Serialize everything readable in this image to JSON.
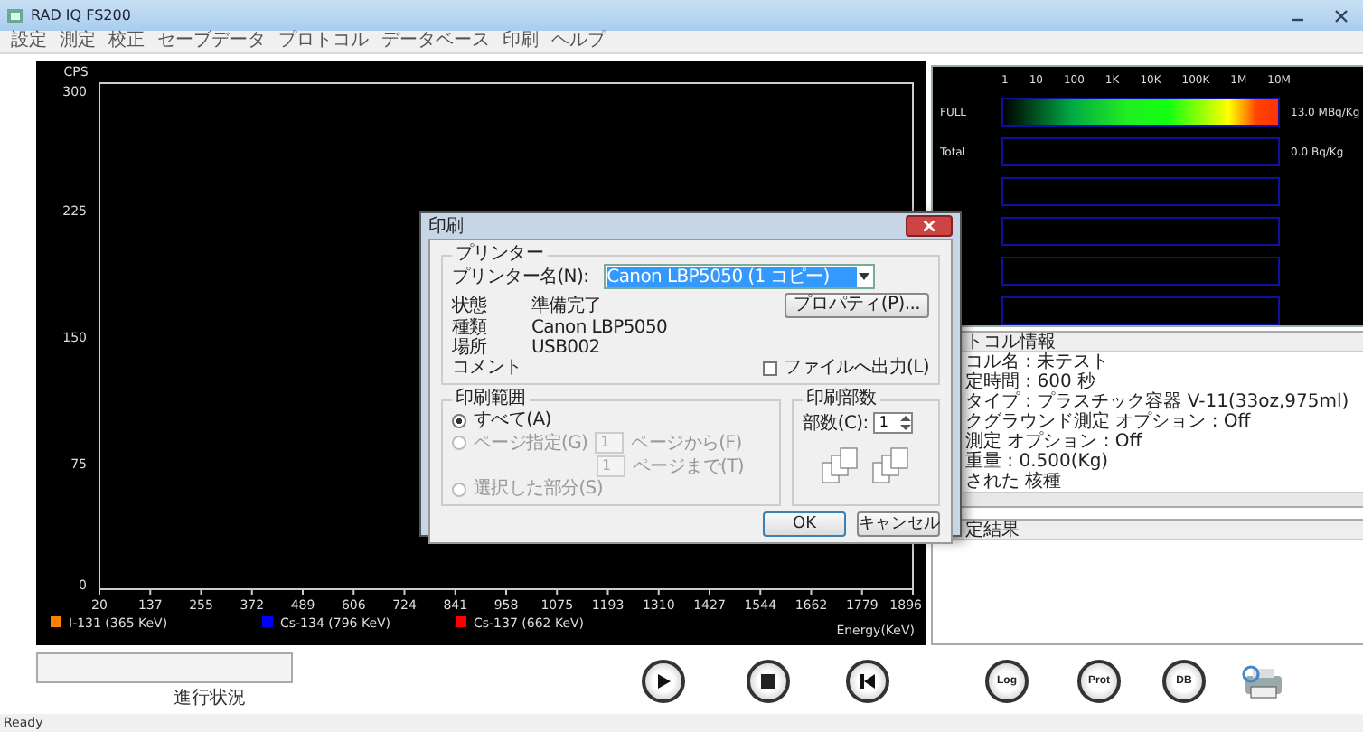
{
  "window": {
    "title": "RAD IQ FS200"
  },
  "menu": [
    "設定",
    "測定",
    "校正",
    "セーブデータ",
    "プロトコル",
    "データベース",
    "印刷",
    "ヘルプ"
  ],
  "spectrum": {
    "y_axis_label": "CPS",
    "y_ticks": [
      "300",
      "225",
      "150",
      "75",
      "0"
    ],
    "x_ticks": [
      "20",
      "137",
      "255",
      "372",
      "489",
      "606",
      "724",
      "841",
      "958",
      "1075",
      "1193",
      "1310",
      "1427",
      "1544",
      "1662",
      "1779",
      "1896"
    ],
    "x_axis_label": "Energy(KeV)",
    "legend": [
      {
        "name": "I-131 (365 KeV)",
        "color": "#ff8000"
      },
      {
        "name": "Cs-134 (796 KeV)",
        "color": "#0000ff"
      },
      {
        "name": "Cs-137 (662 KeV)",
        "color": "#ff0000"
      }
    ]
  },
  "progress": {
    "label": "進行状況"
  },
  "controls": [
    {
      "kind": "play"
    },
    {
      "kind": "stop"
    },
    {
      "kind": "rewind"
    },
    {
      "kind": "text",
      "label": "Log"
    },
    {
      "kind": "text",
      "label": "Prot"
    },
    {
      "kind": "db",
      "label": "DB"
    },
    {
      "kind": "printer"
    }
  ],
  "activity": {
    "scale": [
      "1",
      "10",
      "100",
      "1K",
      "10K",
      "100K",
      "1M",
      "10M"
    ],
    "rows": [
      {
        "kind": "scale",
        "label": "FULL",
        "reading": "13.0 MBq/Kg"
      },
      {
        "kind": "bar",
        "label": "Total",
        "reading": "0.0 Bq/Kg"
      },
      {
        "kind": "bar"
      },
      {
        "kind": "bar"
      },
      {
        "kind": "bar"
      },
      {
        "kind": "bar"
      }
    ]
  },
  "protocol_info": {
    "title": "トコル情報",
    "lines": [
      "コル名 : 未テスト",
      "定時間 : 600 秒",
      "タイプ : プラスチック容器 V-11(33oz,975ml)",
      "クグラウンド測定 オプション : Off",
      "測定 オプション : Off",
      "重量 : 0.500(Kg)",
      "された 核種"
    ]
  },
  "result": {
    "title": "定結果"
  },
  "status_bar": "Ready",
  "print_dialog": {
    "title": "印刷",
    "printer_group": {
      "title": "プリンター",
      "name_label": "プリンター名(N):",
      "name_value": "Canon LBP5050 (1 コピー)",
      "properties_button": "プロパティ(P)...",
      "details": [
        {
          "label": "状態",
          "value": "準備完了"
        },
        {
          "label": "種類",
          "value": "Canon LBP5050"
        },
        {
          "label": "場所",
          "value": "USB002"
        },
        {
          "label": "コメント"
        }
      ],
      "print_to_file": {
        "label": "ファイルへ出力(L)",
        "checked": false
      }
    },
    "range_group": {
      "title": "印刷範囲",
      "options": [
        {
          "label": "すべて(A)",
          "selected": true,
          "disabled": false
        },
        {
          "label": "ページ指定(G)",
          "selected": false,
          "disabled": true
        },
        {
          "label": "選択した部分(S)",
          "selected": false,
          "disabled": true
        }
      ],
      "from": {
        "value": "1",
        "label": "ページから(F)"
      },
      "to": {
        "value": "1",
        "label": "ページまで(T)"
      }
    },
    "copies_group": {
      "title": "印刷部数",
      "label": "部数(C):",
      "value": "1"
    },
    "buttons": [
      "OK",
      "キャンセル"
    ]
  }
}
